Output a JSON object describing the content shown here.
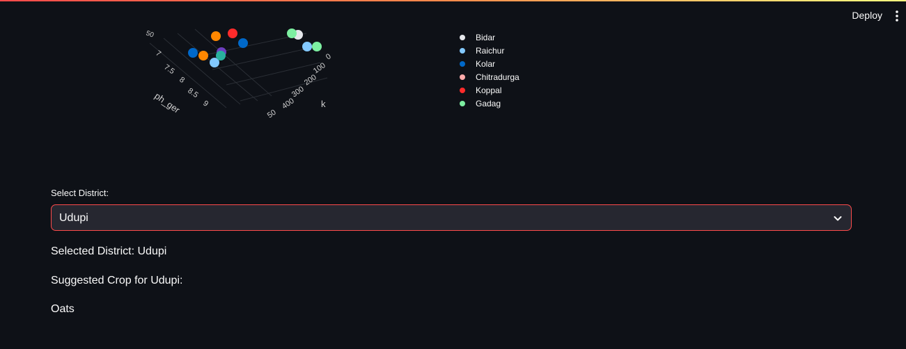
{
  "header": {
    "deploy_label": "Deploy",
    "menu_icon": "kebab-menu-icon"
  },
  "chart_data": {
    "type": "scatter",
    "title": "",
    "axis_labels": {
      "ph_axis_label": "ph_ger",
      "k_axis_label": "k"
    },
    "ph_ticks": [
      "7",
      "7.5",
      "8",
      "8.5",
      "9"
    ],
    "k_ticks": [
      "0",
      "100",
      "200",
      "300",
      "400",
      "50"
    ],
    "z_tick": "50",
    "legend": [
      {
        "name": "Bidar",
        "color": "#e5e7eb"
      },
      {
        "name": "Raichur",
        "color": "#83c9ff"
      },
      {
        "name": "Kolar",
        "color": "#0068c9"
      },
      {
        "name": "Chitradurga",
        "color": "#ffabab"
      },
      {
        "name": "Koppal",
        "color": "#ff2b2b"
      },
      {
        "name": "Gadag",
        "color": "#7defa1"
      }
    ],
    "points": [
      {
        "series": "Kolar"
      },
      {
        "series": "Orange"
      },
      {
        "series": "Raichur"
      },
      {
        "series": "Purple"
      },
      {
        "series": "Teal"
      },
      {
        "series": "Kolar"
      },
      {
        "series": "Raichur"
      },
      {
        "series": "Gadag"
      },
      {
        "series": "Koppal"
      },
      {
        "series": "Bidar"
      },
      {
        "series": "Gadag"
      },
      {
        "series": "Orange"
      }
    ],
    "extra_colors": {
      "Orange": "#ff8700",
      "Purple": "#6d3fc0",
      "Teal": "#29b09d"
    }
  },
  "form": {
    "select_label": "Select District:",
    "selected_value": "Udupi"
  },
  "results": {
    "selected_district_text": "Selected District: Udupi",
    "suggested_crop_heading": "Suggested Crop for Udupi:",
    "crop": "Oats"
  }
}
